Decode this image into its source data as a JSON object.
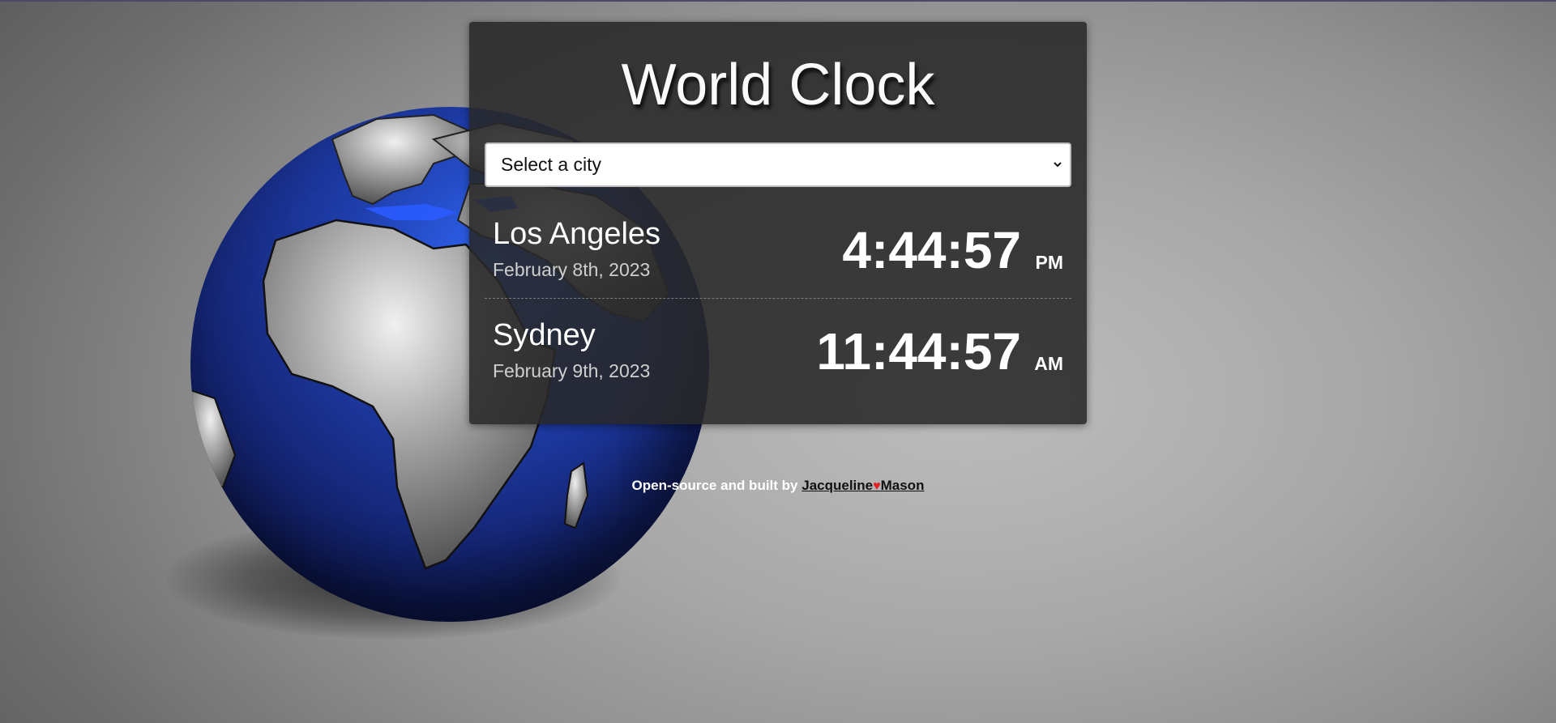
{
  "app": {
    "title": "World Clock"
  },
  "city_select": {
    "selected": "Select a city"
  },
  "cities": [
    {
      "name": "Los Angeles",
      "date": "February 8th, 2023",
      "time": "4:44:57",
      "ampm": "PM"
    },
    {
      "name": "Sydney",
      "date": "February 9th, 2023",
      "time": "11:44:57",
      "ampm": "AM"
    }
  ],
  "footer": {
    "prefix": "Open-source and built by",
    "author_first": "Jacqueline",
    "heart": "♥",
    "author_last": "Mason"
  },
  "colors": {
    "card_background": "#282828",
    "heart": "#e02020",
    "globe_ocean": "#1f3fae"
  },
  "icons": {
    "select": "chevron-down-icon",
    "footer": "heart-icon",
    "background": "globe-image"
  }
}
